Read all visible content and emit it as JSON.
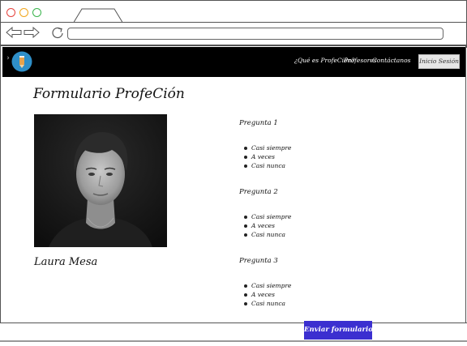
{
  "colors": {
    "navbar_bg": "#000000",
    "submit_bg": "#3b2fd0",
    "login_bg": "#e6e6e6",
    "logo_bg": "#2f8fc8",
    "logo_fg": "#e8a24a"
  },
  "browser": {
    "url": ""
  },
  "navbar": {
    "links": [
      {
        "label": "¿Qué es ProfeCión?"
      },
      {
        "label": "Profesores"
      },
      {
        "label": "Contáctanos"
      }
    ],
    "login_label": "Inicio Sesión"
  },
  "page": {
    "title": "Formulario ProfeCión",
    "person_name": "Laura Mesa"
  },
  "questions": [
    {
      "label": "Pregunta 1",
      "options": [
        "Casi siempre",
        "A veces",
        "Casi nunca"
      ]
    },
    {
      "label": "Pregunta 2",
      "options": [
        "Casi siempre",
        "A veces",
        "Casi nunca"
      ]
    },
    {
      "label": "Pregunta 3",
      "options": [
        "Casi siempre",
        "A veces",
        "Casi nunca"
      ]
    }
  ],
  "submit_label": "Enviar formulario",
  "icons": {
    "back": "back-arrow-icon",
    "forward": "forward-arrow-icon",
    "reload": "reload-icon",
    "sidebar": "chevron-right-icon",
    "logo": "pencil-logo-icon"
  }
}
